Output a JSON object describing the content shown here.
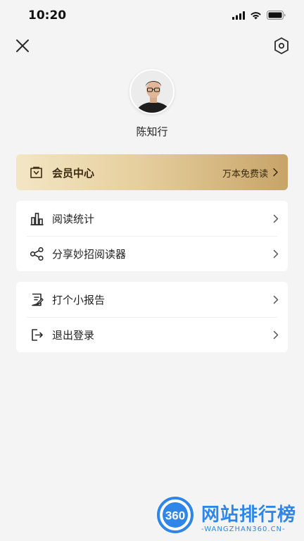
{
  "status_bar": {
    "time": "10:20"
  },
  "profile": {
    "name": "陈知行"
  },
  "vip": {
    "label": "会员中心",
    "promo": "万本免费读"
  },
  "menu_group_1": [
    {
      "label": "阅读统计",
      "icon": "bar-chart-icon"
    },
    {
      "label": "分享妙招阅读器",
      "icon": "share-icon"
    }
  ],
  "menu_group_2": [
    {
      "label": "打个小报告",
      "icon": "report-icon"
    },
    {
      "label": "退出登录",
      "icon": "logout-icon"
    }
  ],
  "watermark": {
    "logo_text": "360",
    "title": "网站排行榜",
    "subtitle": "-WANGZHAN360.CN-"
  },
  "colors": {
    "background": "#f4f4f4",
    "vip_gradient_start": "#f3e6c4",
    "vip_gradient_end": "#c7a468",
    "watermark_blue": "#2f86e6"
  }
}
